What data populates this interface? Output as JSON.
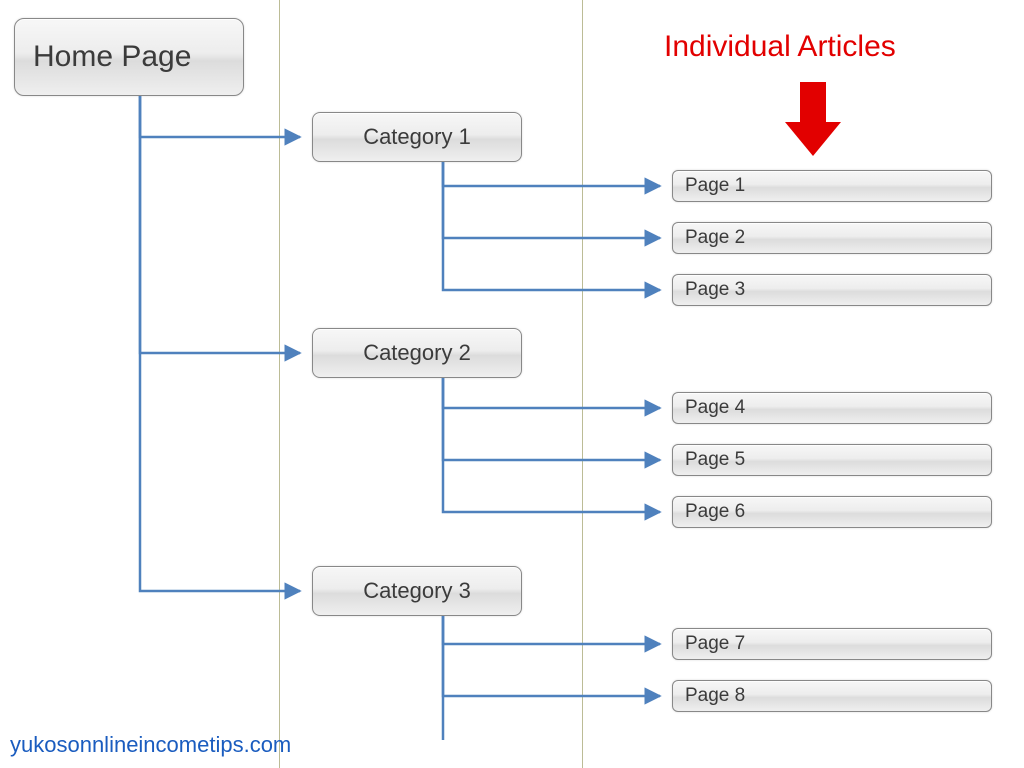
{
  "root": {
    "label": "Home Page"
  },
  "categories": [
    {
      "label": "Category 1",
      "pages": [
        {
          "label": "Page 1"
        },
        {
          "label": "Page 2"
        },
        {
          "label": "Page 3"
        }
      ]
    },
    {
      "label": "Category 2",
      "pages": [
        {
          "label": "Page 4"
        },
        {
          "label": "Page 5"
        },
        {
          "label": "Page 6"
        }
      ]
    },
    {
      "label": "Category 3",
      "pages": [
        {
          "label": "Page 7"
        },
        {
          "label": "Page 8"
        }
      ]
    }
  ],
  "annotation": {
    "label": "Individual Articles"
  },
  "footer": {
    "text": "yukosonnlineincometips.com"
  },
  "colors": {
    "connector": "#4f81bd",
    "guide": "#8f8f50",
    "annotation": "#e20000",
    "link": "#1a5cbf"
  }
}
